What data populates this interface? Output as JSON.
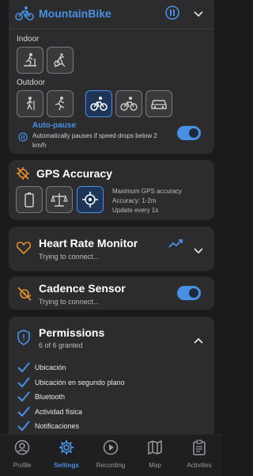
{
  "header": {
    "title": "MountainBike"
  },
  "activity": {
    "indoor_label": "Indoor",
    "outdoor_label": "Outdoor",
    "autopause_title": "Auto-pause",
    "autopause_desc": "Automatically pauses if speed drops below 2 km/h"
  },
  "gps": {
    "title": "GPS Accuracy",
    "line1": "Maximum GPS accuracy",
    "line2": "Accuracy: 1-2m",
    "line3": "Update every 1s"
  },
  "heart_rate": {
    "title": "Heart Rate Monitor",
    "status": "Trying to connect..."
  },
  "cadence": {
    "title": "Cadence Sensor",
    "status": "Trying to connect..."
  },
  "permissions": {
    "title": "Permissions",
    "count": "6 of 6 granted",
    "items": [
      "Ubicación",
      "Ubicación en segundo plano",
      "Bluetooth",
      "Actividad física",
      "Notificaciones"
    ]
  },
  "nav": {
    "profile": "Profile",
    "settings": "Settings",
    "recording": "Recording",
    "map": "Map",
    "activities": "Activities"
  },
  "colors": {
    "accent": "#4a90e2",
    "warning": "#e8912d",
    "card": "#2c2c2f",
    "background": "#1b1b1d"
  }
}
